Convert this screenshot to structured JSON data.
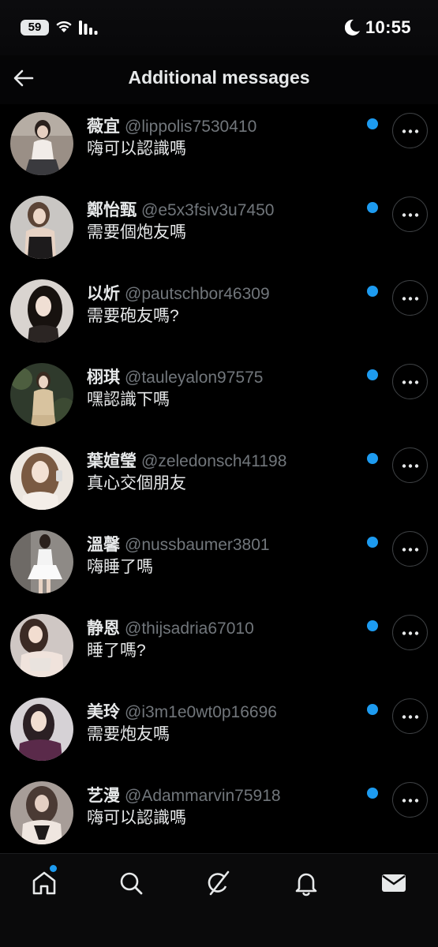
{
  "status": {
    "battery": "59",
    "time": "10:55"
  },
  "header": {
    "title": "Additional messages"
  },
  "messages": [
    {
      "name": "薇宜",
      "handle": "@lippolis7530410",
      "text": "嗨可以認識嗎"
    },
    {
      "name": "鄭怡甄",
      "handle": "@e5x3fsiv3u7450",
      "text": "需要個炮友嗎"
    },
    {
      "name": "以炘",
      "handle": "@pautschbor46309",
      "text": "需要砲友嗎?"
    },
    {
      "name": "栩琪",
      "handle": "@tauleyalon97575",
      "text": "嘿認識下嗎"
    },
    {
      "name": "葉媗瑩",
      "handle": "@zeledonsch41198",
      "text": "真心交個朋友"
    },
    {
      "name": "溫馨",
      "handle": "@nussbaumer3801",
      "text": "嗨睡了嗎"
    },
    {
      "name": "静恩",
      "handle": "@thijsadria67010",
      "text": "睡了嗎?"
    },
    {
      "name": "美玲",
      "handle": "@i3m1e0wt0p16696",
      "text": "需要炮友嗎"
    },
    {
      "name": "艺漫",
      "handle": "@Adammarvin75918",
      "text": "嗨可以認識嗎"
    }
  ],
  "nav": {
    "items": [
      "home-icon",
      "search-icon",
      "grok-icon",
      "bell-icon",
      "mail-icon"
    ],
    "accent": "#1d9bf0"
  },
  "colors": {
    "background": "#000000",
    "unread": "#1d9bf0",
    "handle": "#71767b"
  }
}
